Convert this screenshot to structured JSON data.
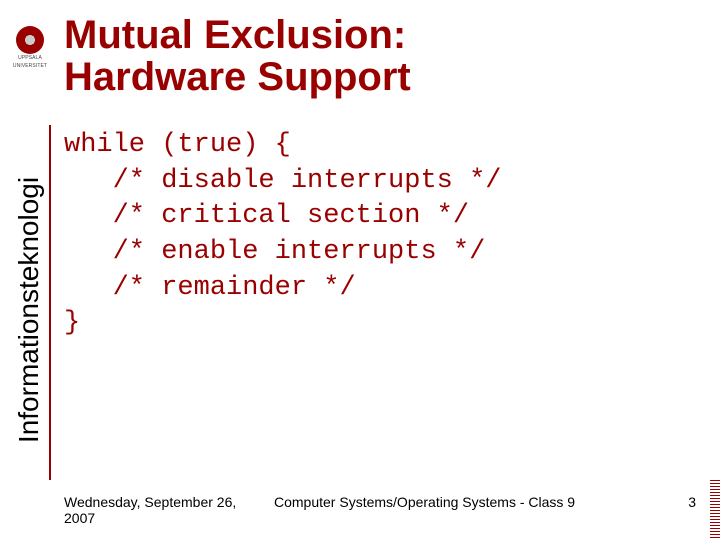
{
  "logo": {
    "line1": "UPPSALA",
    "line2": "UNIVERSITET"
  },
  "title": "Mutual Exclusion:\nHardware Support",
  "sidebar_label": "Informationsteknologi",
  "code": "while (true) {\n   /* disable interrupts */\n   /* critical section */\n   /* enable interrupts */\n   /* remainder */\n}",
  "footer": {
    "date": "Wednesday, September 26, 2007",
    "center": "Computer Systems/Operating Systems - Class 9",
    "page": "3"
  }
}
